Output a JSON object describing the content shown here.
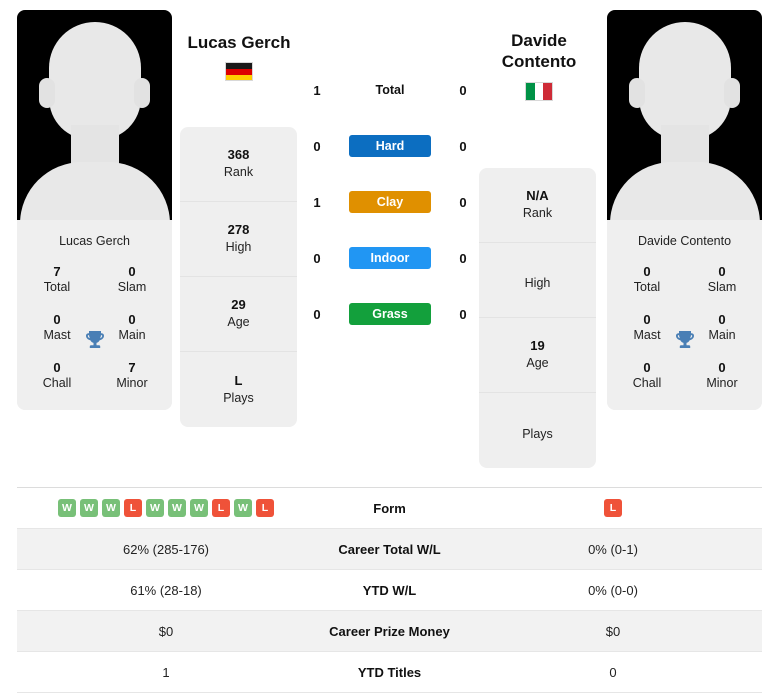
{
  "colors": {
    "hard": "#0c6ec1",
    "clay": "#e09000",
    "indoor": "#2196f3",
    "grass": "#13a03c",
    "win": "#78c078",
    "loss": "#ef5239",
    "trophy": "#4a7fb5",
    "panel": "#efefef",
    "row_alt": "#f2f2f2"
  },
  "players": {
    "left": {
      "name": "Lucas Gerch",
      "card_name": "Lucas Gerch",
      "country": "Germany",
      "flag": "de-flag",
      "titles": [
        {
          "num": "7",
          "label": "Total"
        },
        {
          "num": "0",
          "label": "Slam"
        },
        {
          "num": "0",
          "label": "Mast"
        },
        {
          "num": "0",
          "label": "Main"
        },
        {
          "num": "0",
          "label": "Chall"
        },
        {
          "num": "7",
          "label": "Minor"
        }
      ],
      "info": [
        {
          "value": "368",
          "key": "Rank"
        },
        {
          "value": "278",
          "key": "High"
        },
        {
          "value": "29",
          "key": "Age"
        },
        {
          "value": "L",
          "key": "Plays"
        }
      ]
    },
    "right": {
      "name_line1": "Davide",
      "name_line2": "Contento",
      "card_name": "Davide Contento",
      "country": "Italy",
      "flag": "it-flag",
      "titles": [
        {
          "num": "0",
          "label": "Total"
        },
        {
          "num": "0",
          "label": "Slam"
        },
        {
          "num": "0",
          "label": "Mast"
        },
        {
          "num": "0",
          "label": "Main"
        },
        {
          "num": "0",
          "label": "Chall"
        },
        {
          "num": "0",
          "label": "Minor"
        }
      ],
      "info": [
        {
          "value": "N/A",
          "key": "Rank"
        },
        {
          "value": "",
          "key": "High"
        },
        {
          "value": "19",
          "key": "Age"
        },
        {
          "value": "",
          "key": "Plays"
        }
      ]
    }
  },
  "surfaces": [
    {
      "label": "Total",
      "style": "plain",
      "color": "",
      "left": "1",
      "right": "0"
    },
    {
      "label": "Hard",
      "style": "chip",
      "color": "#0c6ec1",
      "left": "0",
      "right": "0"
    },
    {
      "label": "Clay",
      "style": "chip",
      "color": "#e09000",
      "left": "1",
      "right": "0"
    },
    {
      "label": "Indoor",
      "style": "chip",
      "color": "#2196f3",
      "left": "0",
      "right": "0"
    },
    {
      "label": "Grass",
      "style": "chip",
      "color": "#13a03c",
      "left": "0",
      "right": "0"
    }
  ],
  "stats_table": {
    "form_label": "Form",
    "left_form": [
      "W",
      "W",
      "W",
      "L",
      "W",
      "W",
      "W",
      "L",
      "W",
      "L"
    ],
    "right_form": [
      "L"
    ],
    "rows": [
      {
        "label": "Career Total W/L",
        "left": "62% (285-176)",
        "right": "0% (0-1)"
      },
      {
        "label": "YTD W/L",
        "left": "61% (28-18)",
        "right": "0% (0-0)"
      },
      {
        "label": "Career Prize Money",
        "left": "$0",
        "right": "$0"
      },
      {
        "label": "YTD Titles",
        "left": "1",
        "right": "0"
      }
    ]
  }
}
